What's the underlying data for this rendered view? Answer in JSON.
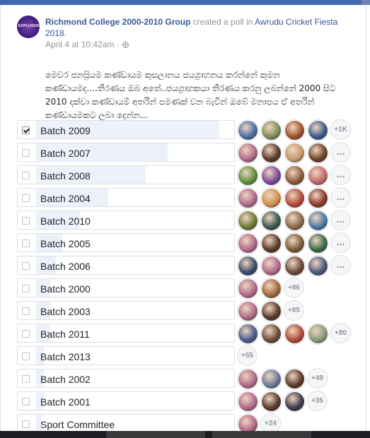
{
  "post": {
    "group_name": "Richmond College 2000-2010 Group",
    "action_text": " created a poll in ",
    "event_name": "Awrudu Cricket Fiesta 2018.",
    "timestamp": "April 4 at 10:42am · ",
    "logo_text": "EXPLOSION",
    "question": "මෙවර ජනප්‍රියම කණ්ඩායම කුසලානය ජයග්‍රාහනය කරන්නේ කුමන කණ්ඩායමද....තීරණය ඔබ අතේ..ජයග්‍රාහකයා තීරණය කරනු ලබන්නේ 2000 සිට 2010 දක්වා කණ්ඩායම් අතරින් පමණක් වන බැවින් ඔබේ මනාපය ඒ අතරින් කණ්ඩායමකට ලබා දෙන්න..."
  },
  "poll": {
    "options": [
      {
        "label": "Batch 2009",
        "checked": true,
        "share": 0.92,
        "avatars": [
          "#4a6fa5",
          "#7d8f5a",
          "#a0522d",
          "#3b5b8c"
        ],
        "more": "+1K"
      },
      {
        "label": "Batch 2007",
        "checked": false,
        "share": 0.66,
        "avatars": [
          "#b06a8a",
          "#5a3a2a",
          "#c49a6c",
          "#6b4226"
        ],
        "more": "..."
      },
      {
        "label": "Batch 2008",
        "checked": false,
        "share": 0.55,
        "avatars": [
          "#5f8f3a",
          "#7a4a9a",
          "#8a5a3a",
          "#c46a6a"
        ],
        "more": "..."
      },
      {
        "label": "Batch 2004",
        "checked": false,
        "share": 0.36,
        "avatars": [
          "#b06a8a",
          "#d0904a",
          "#b04a3a",
          "#8a3a2a"
        ],
        "more": "..."
      },
      {
        "label": "Batch 2010",
        "checked": false,
        "share": 0.22,
        "avatars": [
          "#6a7a3a",
          "#3a5a4a",
          "#8a6a4a",
          "#4a7aa5"
        ],
        "more": "..."
      },
      {
        "label": "Batch 2005",
        "checked": false,
        "share": 0.13,
        "avatars": [
          "#b06a8a",
          "#5a3a2a",
          "#7a5a3a",
          "#3a6a4a"
        ],
        "more": "..."
      },
      {
        "label": "Batch 2006",
        "checked": false,
        "share": 0.1,
        "avatars": [
          "#3a4a6a",
          "#b06a8a",
          "#6a4a3a",
          "#4a5a7a"
        ],
        "more": "..."
      },
      {
        "label": "Batch 2000",
        "checked": false,
        "share": 0.07,
        "avatars": [
          "#b06a8a",
          "#a06a3a"
        ],
        "more": "+86"
      },
      {
        "label": "Batch 2003",
        "checked": false,
        "share": 0.07,
        "avatars": [
          "#b06a8a",
          "#5a3a2a"
        ],
        "more": "+85"
      },
      {
        "label": "Batch 2011",
        "checked": false,
        "share": 0.07,
        "avatars": [
          "#4a5a8a",
          "#6a4a3a",
          "#b04a3a",
          "#8a9a7a"
        ],
        "more": "+80"
      },
      {
        "label": "Batch 2013",
        "checked": false,
        "share": 0.04,
        "avatars": [],
        "more": "+55"
      },
      {
        "label": "Batch 2002",
        "checked": false,
        "share": 0.04,
        "avatars": [
          "#b06a8a",
          "#6a7a9a",
          "#5a3a2a"
        ],
        "more": "+49"
      },
      {
        "label": "Batch 2001",
        "checked": false,
        "share": 0.04,
        "avatars": [
          "#b06a8a",
          "#5a3a2a",
          "#3a3a4a"
        ],
        "more": "+35"
      },
      {
        "label": "Sport Committee",
        "checked": false,
        "share": 0.03,
        "avatars": [
          "#b06a8a"
        ],
        "more": "+24"
      }
    ]
  },
  "colors": {
    "link": "#365899",
    "meta": "#90949c",
    "bar_fill": "#edf2fa",
    "fb_blue": "#4267b2"
  }
}
